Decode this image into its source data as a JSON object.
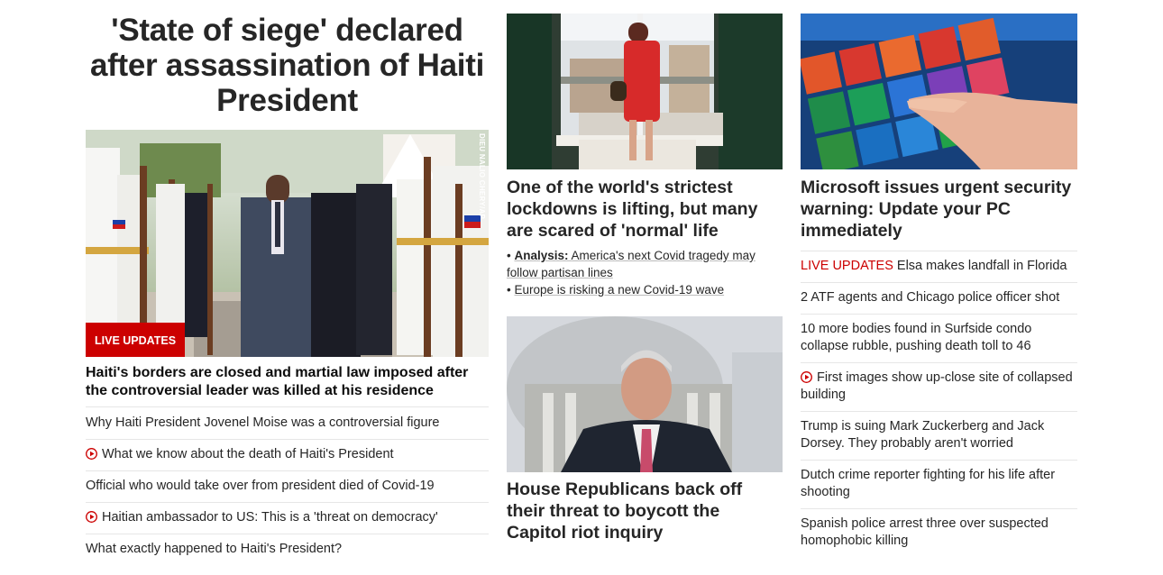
{
  "colors": {
    "accent": "#cc0000",
    "text": "#262626",
    "divider": "#e6e6e6"
  },
  "main_story": {
    "headline": "'State of siege' declared after assassination of Haiti President",
    "photo_credit": "DIEU NALIO CHERY/AP",
    "badge": "LIVE UPDATES",
    "caption": "Haiti's borders are closed and martial law imposed after the controversial leader was killed at his residence",
    "related": [
      {
        "text": "Why Haiti President Jovenel Moise was a controversial figure",
        "icon": ""
      },
      {
        "text": "What we know about the death of Haiti's President",
        "icon": "play-icon"
      },
      {
        "text": "Official who would take over from president died of Covid-19",
        "icon": ""
      },
      {
        "text": "Haitian ambassador to US: This is a 'threat on democracy'",
        "icon": "play-icon"
      },
      {
        "text": "What exactly happened to Haiti's President?",
        "icon": ""
      }
    ]
  },
  "lockdown_story": {
    "headline": "One of the world's strictest lockdowns is lifting, but many are scared of 'normal' life",
    "links": [
      {
        "prefix": "Analysis:",
        "text": "America's next Covid tragedy may follow partisan lines"
      },
      {
        "prefix": "",
        "text": "Europe is risking a new Covid-19 wave"
      }
    ]
  },
  "capitol_story": {
    "headline": "House Republicans back off their threat to boycott the Capitol riot inquiry"
  },
  "microsoft_story": {
    "headline": "Microsoft issues urgent security warning: Update your PC immediately"
  },
  "headlines": [
    {
      "prefix": "LIVE UPDATES",
      "text": "Elsa makes landfall in Florida",
      "icon": ""
    },
    {
      "prefix": "",
      "text": "2 ATF agents and Chicago police officer shot",
      "icon": ""
    },
    {
      "prefix": "",
      "text": "10 more bodies found in Surfside condo collapse rubble, pushing death toll to 46",
      "icon": ""
    },
    {
      "prefix": "",
      "text": "First images show up-close site of collapsed building",
      "icon": "play-icon"
    },
    {
      "prefix": "",
      "text": "Trump is suing Mark Zuckerberg and Jack Dorsey. They probably aren't worried",
      "icon": ""
    },
    {
      "prefix": "",
      "text": "Dutch crime reporter fighting for his life after shooting",
      "icon": ""
    },
    {
      "prefix": "",
      "text": "Spanish police arrest three over suspected homophobic killing",
      "icon": ""
    }
  ]
}
